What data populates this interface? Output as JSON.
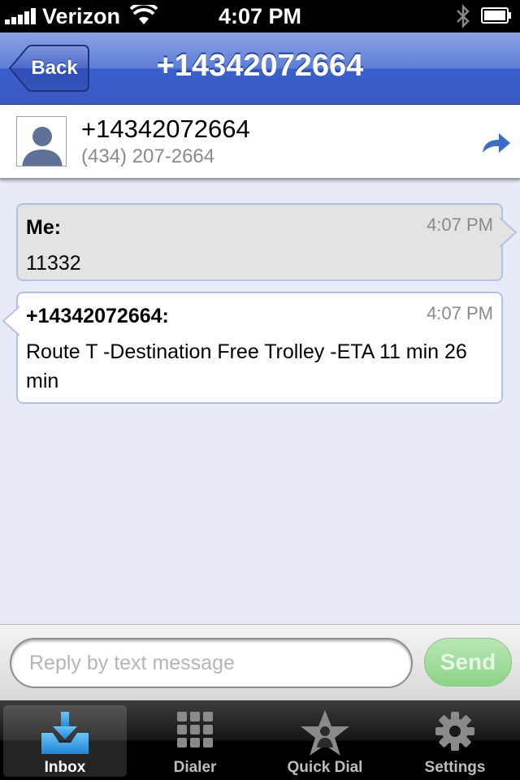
{
  "status_bar": {
    "carrier": "Verizon",
    "time": "4:07 PM"
  },
  "nav": {
    "back_label": "Back",
    "title": "+14342072664"
  },
  "contact": {
    "name": "+14342072664",
    "phone": "(434) 207-2664"
  },
  "messages": [
    {
      "sender": "Me:",
      "time": "4:07 PM",
      "text": "11332"
    },
    {
      "sender": "+14342072664:",
      "time": "4:07 PM",
      "text": "Route T -Destination Free Trolley -ETA 11 min 26 min"
    }
  ],
  "reply": {
    "placeholder": "Reply by text message",
    "send_label": "Send"
  },
  "tabs": [
    {
      "label": "Inbox",
      "icon": "inbox-icon"
    },
    {
      "label": "Dialer",
      "icon": "dialer-keypad-icon"
    },
    {
      "label": "Quick Dial",
      "icon": "star-person-icon"
    },
    {
      "label": "Settings",
      "icon": "gear-icon"
    }
  ],
  "colors": {
    "nav_blue": "#3a5fcb",
    "thread_bg": "#e6ebf7",
    "bubble_border": "#b3c1e6",
    "send_green": "#8bd486",
    "inbox_blue": "#3aa3e8"
  }
}
